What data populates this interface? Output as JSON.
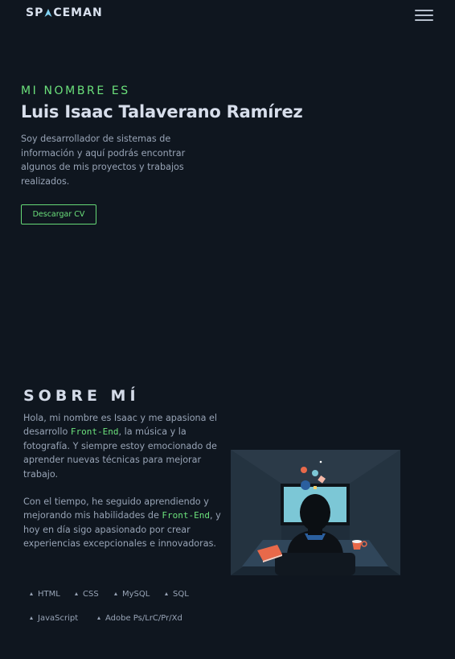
{
  "brand": {
    "logo_text_1": "SP",
    "logo_text_2": "CEMAN"
  },
  "hero": {
    "eyebrow": "MI NOMBRE ES",
    "name": "Luis Isaac Talaverano Ramírez",
    "description": "Soy desarrollador de sistemas de información y aquí podrás encontrar algunos de mis proyectos y trabajos realizados.",
    "cv_button_label": "Descargar CV"
  },
  "about": {
    "title": "SOBRE MÍ",
    "p1_a": "Hola, mi nombre es Isaac y me apasiona el desarrollo ",
    "p1_highlight": "Front-End",
    "p1_b": ", la música y la fotografía. Y siempre estoy emocionado de aprender nuevas técnicas para mejorar trabajo.",
    "p2_a": "Con el tiempo, he seguido aprendiendo y mejorando mis habilidades de ",
    "p2_highlight": "Front-End",
    "p2_b": ", y hoy en día sigo apasionado por crear experiencias excepcionales e innovadoras.",
    "skills": [
      "HTML",
      "CSS",
      "MySQL",
      "SQL",
      "JavaScript",
      "Adobe Ps/LrC/Pr/Xd"
    ]
  },
  "icons": {
    "menu": "hamburger-menu-icon",
    "skill_bullet": "triangle-bullet-icon"
  },
  "colors": {
    "background": "#0f161f",
    "accent": "#6be07b",
    "heading": "#d7deeb",
    "text": "#98a4b6"
  }
}
